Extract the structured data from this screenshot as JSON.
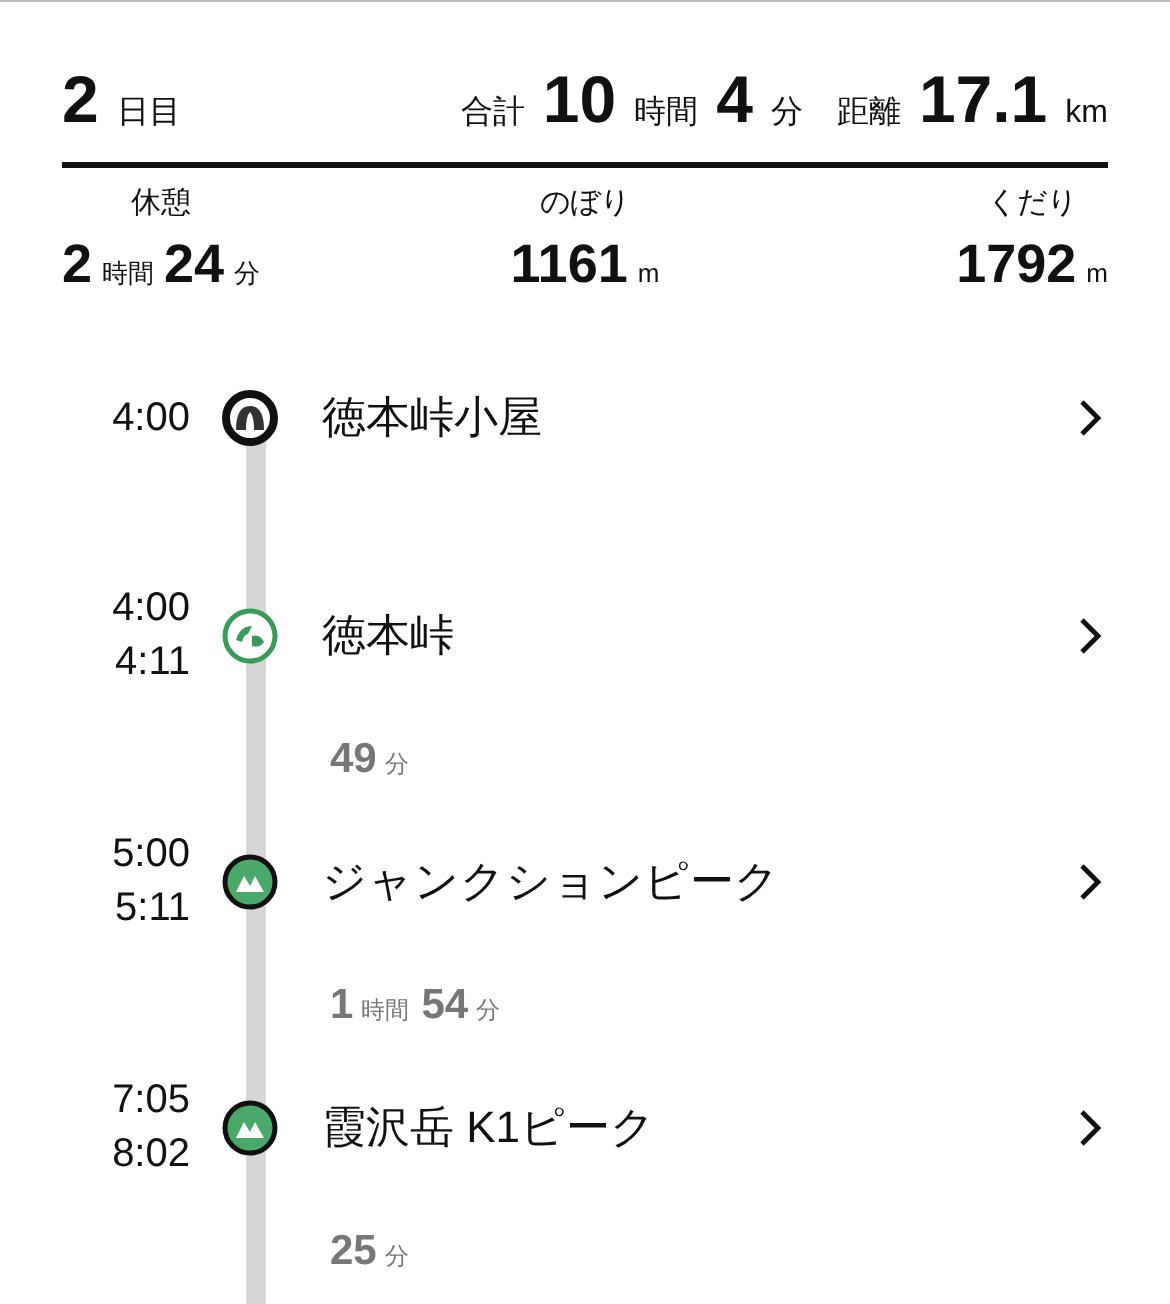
{
  "day": {
    "number": "2",
    "unit": "日目"
  },
  "totals": {
    "time_label": "合計",
    "hours": "10",
    "hours_unit": "時間",
    "minutes": "4",
    "minutes_unit": "分",
    "distance_label": "距離",
    "distance": "17.1",
    "distance_unit": "km"
  },
  "stats": [
    {
      "label": "休憩",
      "parts": [
        {
          "value": "2",
          "unit": "時間"
        },
        {
          "value": "24",
          "unit": "分"
        }
      ]
    },
    {
      "label": "のぼり",
      "parts": [
        {
          "value": "1161",
          "unit": "m"
        }
      ]
    },
    {
      "label": "くだり",
      "parts": [
        {
          "value": "1792",
          "unit": "m"
        }
      ]
    }
  ],
  "timeline": [
    {
      "kind": "hut",
      "times": [
        "4:00"
      ],
      "name": "徳本峠小屋"
    },
    {
      "kind": "pass",
      "times": [
        "4:00",
        "4:11"
      ],
      "name": "徳本峠"
    },
    {
      "kind": "duration",
      "parts": [
        {
          "value": "49",
          "unit": "分"
        }
      ]
    },
    {
      "kind": "peak",
      "times": [
        "5:00",
        "5:11"
      ],
      "name": "ジャンクションピーク"
    },
    {
      "kind": "duration",
      "parts": [
        {
          "value": "1",
          "unit": "時間"
        },
        {
          "value": "54",
          "unit": "分"
        }
      ]
    },
    {
      "kind": "peak",
      "times": [
        "7:05",
        "8:02"
      ],
      "name": "霞沢岳 K1ピーク"
    },
    {
      "kind": "duration",
      "parts": [
        {
          "value": "25",
          "unit": "分"
        }
      ]
    }
  ]
}
